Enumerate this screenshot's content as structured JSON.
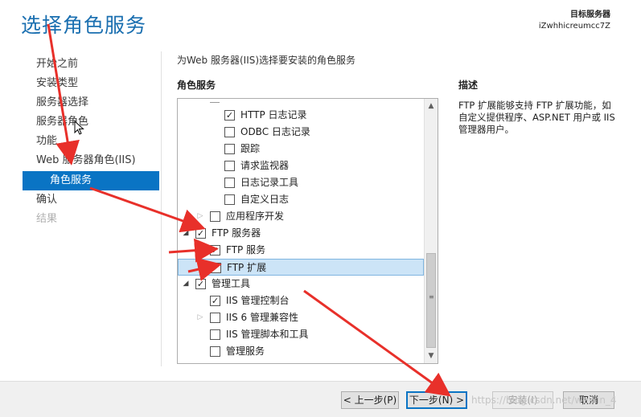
{
  "header": {
    "title": "选择角色服务",
    "dest_label": "目标服务器",
    "dest_server": "iZwhhicreumcc7Z"
  },
  "nav": {
    "items": [
      {
        "label": "开始之前",
        "state": "normal"
      },
      {
        "label": "安装类型",
        "state": "normal"
      },
      {
        "label": "服务器选择",
        "state": "normal"
      },
      {
        "label": "服务器角色",
        "state": "normal"
      },
      {
        "label": "功能",
        "state": "normal"
      },
      {
        "label": "Web 服务器角色(IIS)",
        "state": "normal"
      },
      {
        "label": "角色服务",
        "state": "active"
      },
      {
        "label": "确认",
        "state": "normal"
      },
      {
        "label": "结果",
        "state": "disabled"
      }
    ]
  },
  "main": {
    "intro": "为Web 服务器(IIS)选择要安装的角色服务",
    "roles_heading": "角色服务",
    "description_heading": "描述",
    "description_text": "FTP 扩展能够支持 FTP 扩展功能，如自定义提供程序、ASP.NET 用户或 IIS 管理器用户。"
  },
  "tree": {
    "rows": [
      {
        "label": "HTTP 日志记录",
        "checked": true,
        "expander": "",
        "level": 3
      },
      {
        "label": "ODBC 日志记录",
        "checked": false,
        "expander": "",
        "level": 3
      },
      {
        "label": "跟踪",
        "checked": false,
        "expander": "",
        "level": 3
      },
      {
        "label": "请求监视器",
        "checked": false,
        "expander": "",
        "level": 3
      },
      {
        "label": "日志记录工具",
        "checked": false,
        "expander": "",
        "level": 3
      },
      {
        "label": "自定义日志",
        "checked": false,
        "expander": "",
        "level": 3
      },
      {
        "label": "应用程序开发",
        "checked": false,
        "expander": "collapsed",
        "level": 2
      },
      {
        "label": "FTP 服务器",
        "checked": true,
        "expander": "expanded",
        "level": 1
      },
      {
        "label": "FTP 服务",
        "checked": true,
        "expander": "",
        "level": 2
      },
      {
        "label": "FTP 扩展",
        "checked": true,
        "expander": "",
        "level": 2,
        "selected": true
      },
      {
        "label": "管理工具",
        "checked": true,
        "expander": "expanded",
        "level": 1
      },
      {
        "label": "IIS 管理控制台",
        "checked": true,
        "expander": "",
        "level": 2
      },
      {
        "label": "IIS 6 管理兼容性",
        "checked": false,
        "expander": "collapsed",
        "level": 2
      },
      {
        "label": "IIS 管理脚本和工具",
        "checked": false,
        "expander": "",
        "level": 2
      },
      {
        "label": "管理服务",
        "checked": false,
        "expander": "",
        "level": 2
      }
    ]
  },
  "icons": {
    "check": "✓",
    "expanded": "◢",
    "collapsed": "▷",
    "scroll_up": "▲",
    "scroll_down": "▼"
  },
  "footer": {
    "prev_label": "< 上一步(P)",
    "next_label": "下一步(N) >",
    "install_label": "安装(I)",
    "cancel_label": "取消"
  },
  "watermark": "https://blog.csdn.net/weixin_4",
  "colors": {
    "accent": "#0a74c4",
    "title": "#1a6fb0",
    "annotation": "#e8302a"
  }
}
